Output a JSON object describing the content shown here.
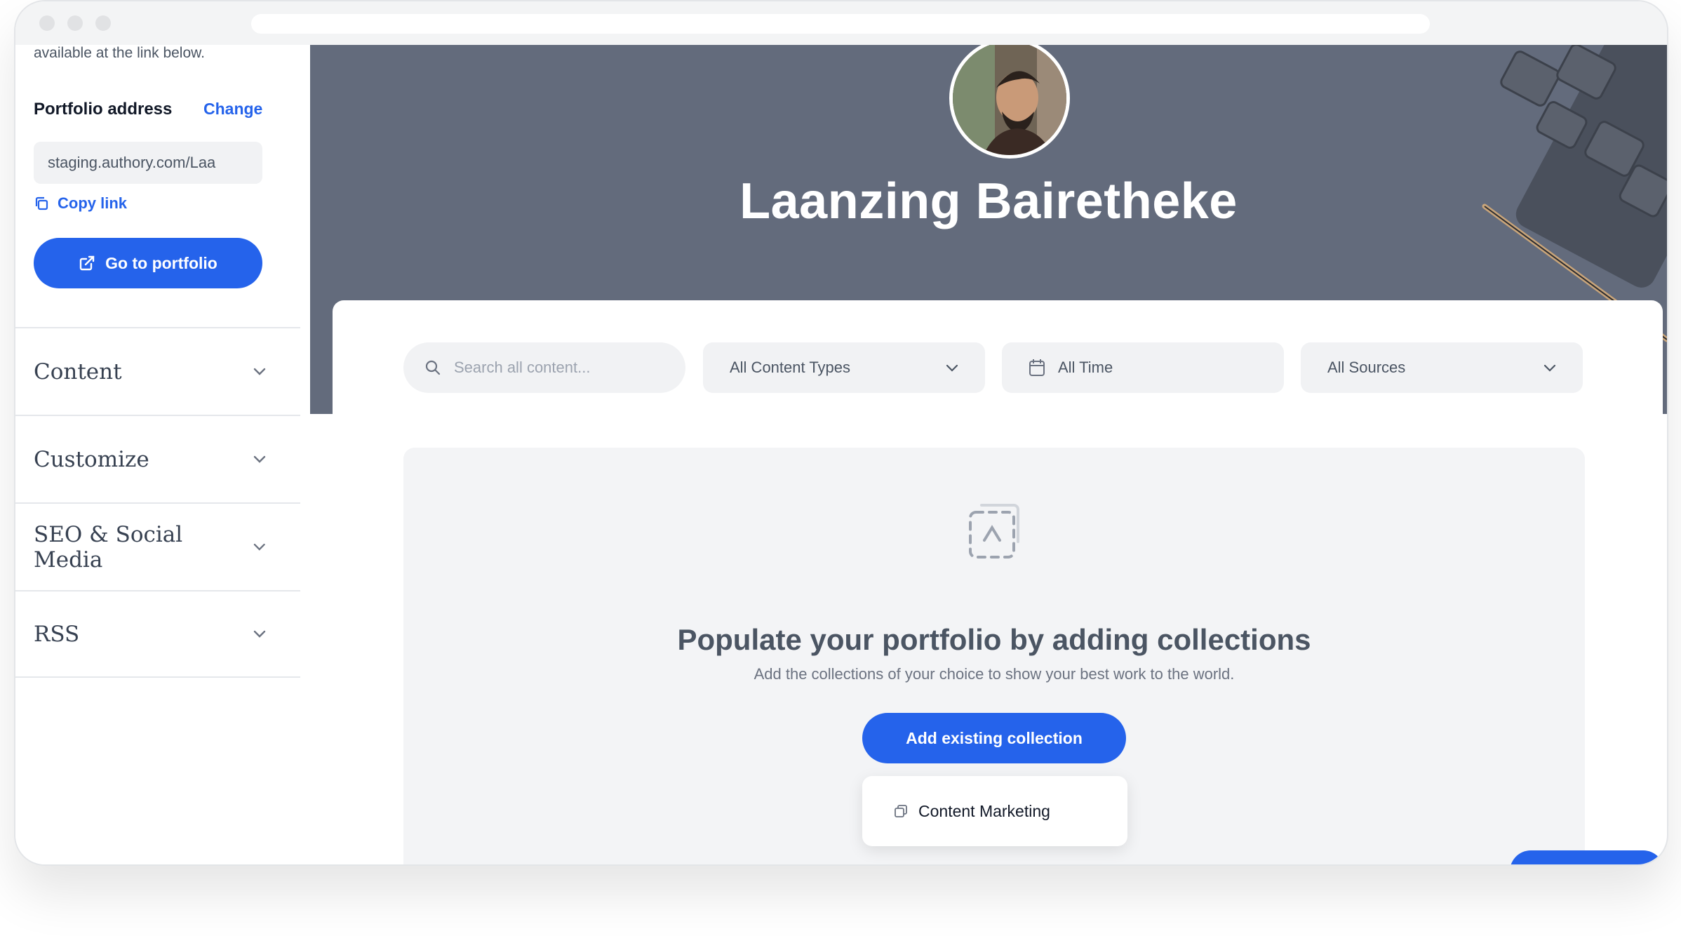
{
  "sidebar": {
    "intro_text": "available at the link below.",
    "portfolio_address_label": "Portfolio address",
    "change_label": "Change",
    "address_value": "staging.authory.com/Laa",
    "copy_link_label": "Copy link",
    "go_to_portfolio_label": "Go to portfolio",
    "sections": [
      {
        "label": "Content"
      },
      {
        "label": "Customize"
      },
      {
        "label": "SEO & Social Media"
      },
      {
        "label": "RSS"
      }
    ]
  },
  "hero": {
    "name": "Laanzing Bairetheke"
  },
  "filters": {
    "search_placeholder": "Search all content...",
    "content_types": "All Content Types",
    "time": "All Time",
    "sources": "All Sources"
  },
  "empty_state": {
    "title": "Populate your portfolio by adding collections",
    "subtitle": "Add the collections of your choice to show your best work to the world.",
    "button_label": "Add existing collection",
    "dropdown_items": [
      {
        "label": "Content Marketing"
      }
    ]
  },
  "colors": {
    "accent": "#2563eb",
    "hero_bg": "#636b7c"
  },
  "icons": [
    "search-icon",
    "calendar-icon",
    "chevron-down-icon",
    "copy-icon",
    "external-link-icon",
    "collection-icon"
  ]
}
